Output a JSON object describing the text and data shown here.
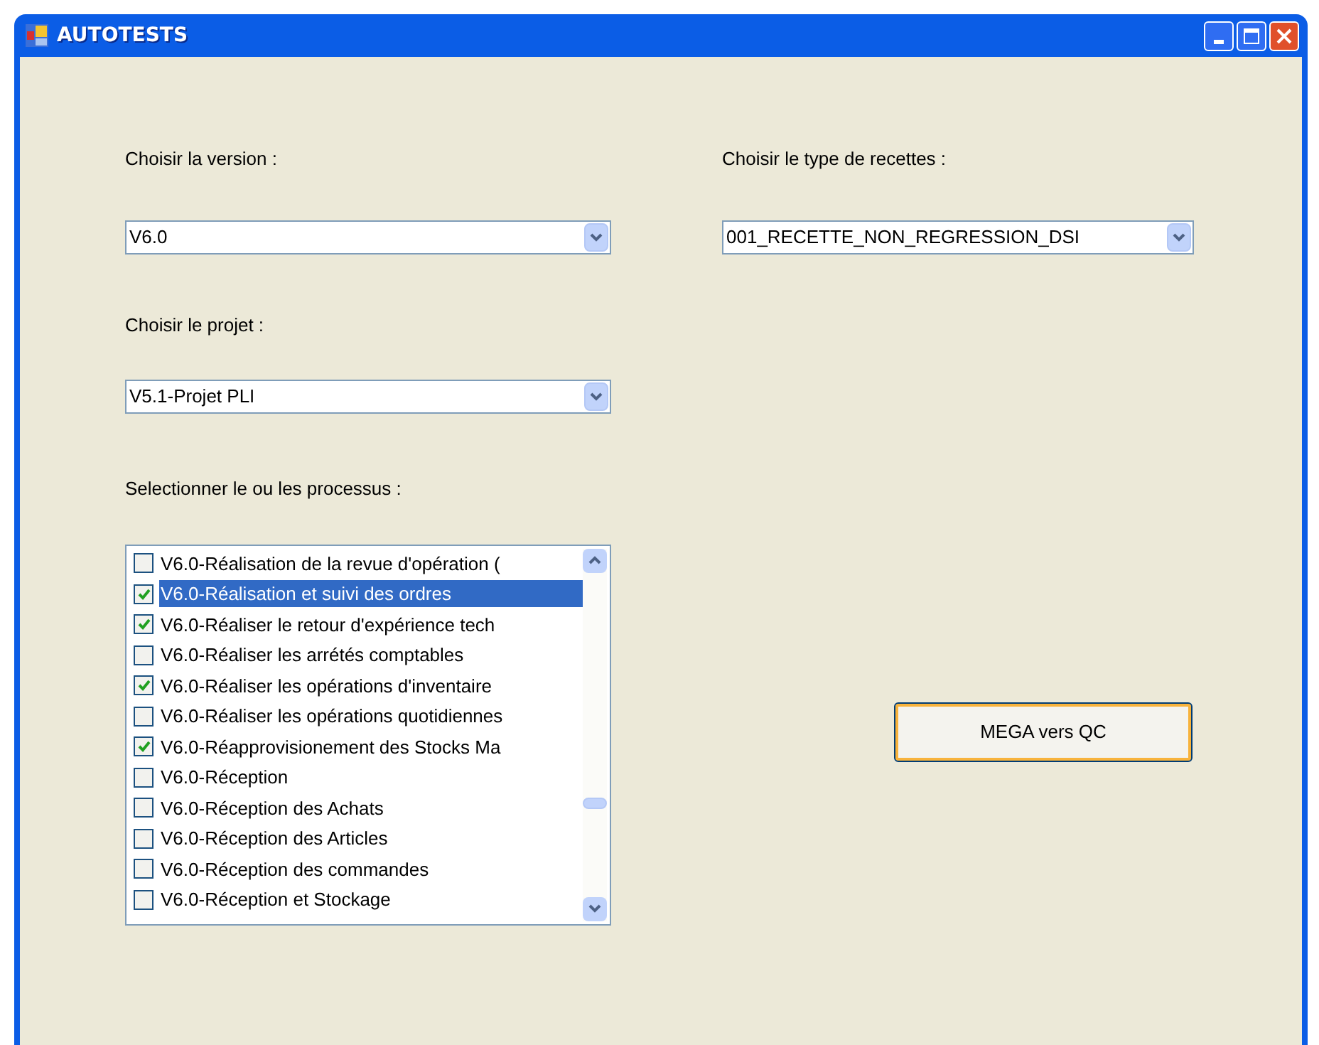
{
  "window": {
    "title": "AUTOTESTS"
  },
  "version": {
    "label": "Choisir la version :",
    "value": "V6.0"
  },
  "project": {
    "label": "Choisir le projet :",
    "value": "V5.1-Projet PLI"
  },
  "recipe_type": {
    "label": "Choisir le type de recettes :",
    "value": "001_RECETTE_NON_REGRESSION_DSI"
  },
  "processes": {
    "label": "Selectionner le ou les processus :",
    "items": [
      {
        "label": "V6.0-Réalisation de la revue d'opération (",
        "checked": false,
        "selected": false
      },
      {
        "label": "V6.0-Réalisation et suivi des ordres",
        "checked": true,
        "selected": true
      },
      {
        "label": "V6.0-Réaliser le retour d'expérience tech",
        "checked": true,
        "selected": false
      },
      {
        "label": "V6.0-Réaliser les arrétés comptables",
        "checked": false,
        "selected": false
      },
      {
        "label": "V6.0-Réaliser les opérations d'inventaire",
        "checked": true,
        "selected": false
      },
      {
        "label": "V6.0-Réaliser les opérations quotidiennes",
        "checked": false,
        "selected": false
      },
      {
        "label": "V6.0-Réapprovisionement des Stocks Ma",
        "checked": true,
        "selected": false
      },
      {
        "label": "V6.0-Réception",
        "checked": false,
        "selected": false
      },
      {
        "label": "V6.0-Réception des Achats",
        "checked": false,
        "selected": false
      },
      {
        "label": "V6.0-Réception des Articles",
        "checked": false,
        "selected": false
      },
      {
        "label": "V6.0-Réception des commandes",
        "checked": false,
        "selected": false
      },
      {
        "label": "V6.0-Réception et Stockage",
        "checked": false,
        "selected": false
      }
    ]
  },
  "buttons": [
    "MEGA vers QC"
  ]
}
